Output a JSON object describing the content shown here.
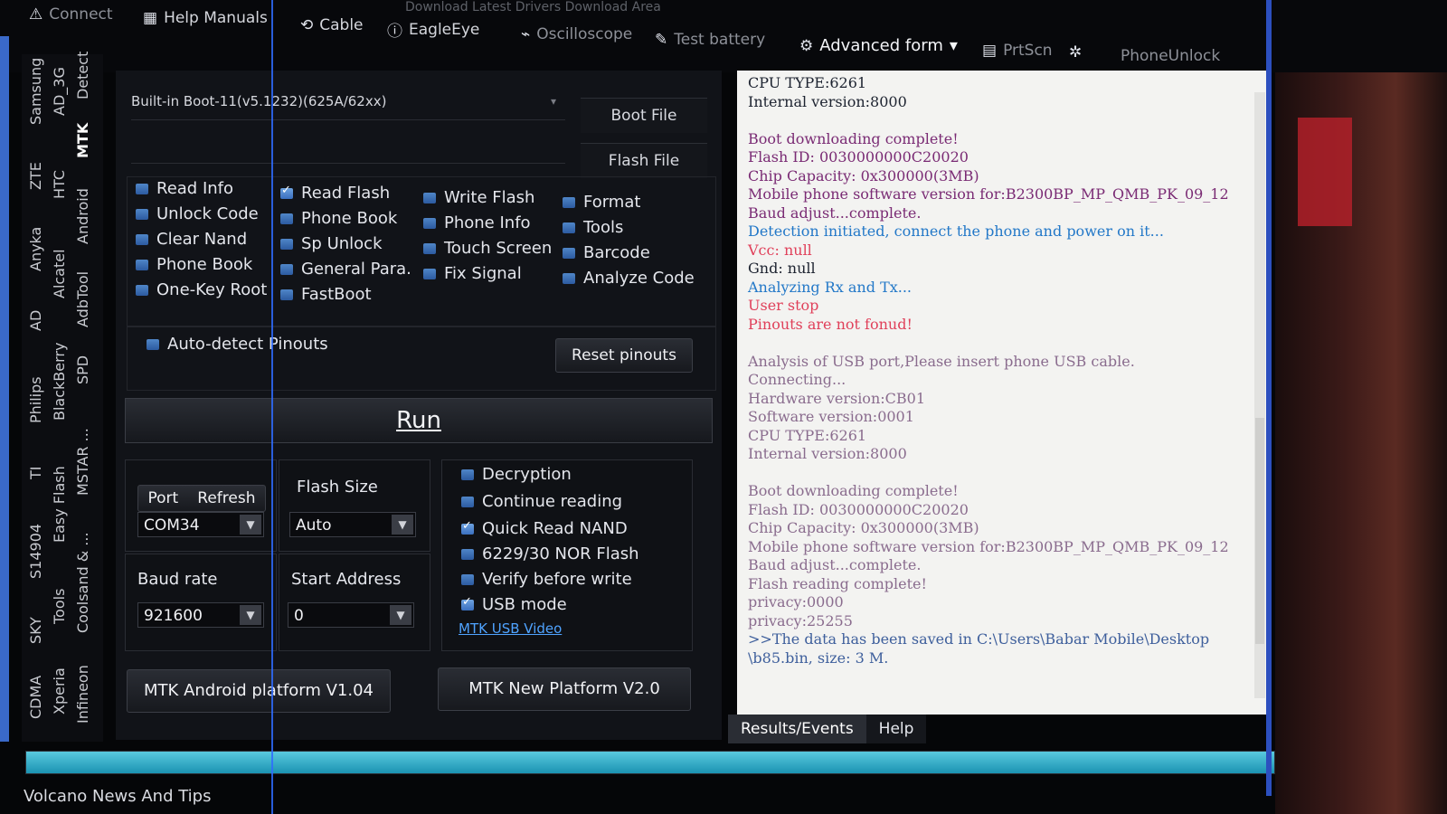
{
  "toolbar": {
    "faint_top": "Download Latest Drivers   Download Area",
    "items": [
      {
        "icon": "warning-icon",
        "glyph": "⚠",
        "label": "Connect"
      },
      {
        "icon": "book-icon",
        "glyph": "▦",
        "label": "Help Manuals"
      },
      {
        "icon": "refresh-icon",
        "glyph": "⟲",
        "label": "Cable"
      },
      {
        "icon": "info-icon",
        "glyph": "ⓘ",
        "label": "EagleEye"
      },
      {
        "icon": "oscilloscope-icon",
        "glyph": "⌁",
        "label": "Oscilloscope"
      },
      {
        "icon": "wrench-icon",
        "glyph": "✎",
        "label": "Test battery"
      },
      {
        "icon": "gear-icon",
        "glyph": "⚙",
        "label": "Advanced form"
      },
      {
        "icon": "screenshot-icon",
        "glyph": "▤",
        "label": "PrtScn"
      },
      {
        "icon": "settings-icon",
        "glyph": "✲",
        "label": ""
      },
      {
        "icon": "apple-icon",
        "glyph": "",
        "label": "PhoneUnlock"
      }
    ]
  },
  "vertical_tabs": {
    "col1": [
      "CDMA",
      "SKY",
      "S14904",
      "TI",
      "Philips",
      "AD",
      "Anyka",
      "ZTE",
      "Samsung"
    ],
    "col2": [
      "Xperia",
      "Tools",
      "Easy Flash",
      "BlackBerry",
      "Alcatel",
      "HTC",
      "AD_3G"
    ],
    "col3": [
      "Infineon",
      "Coolsand & ...",
      "MSTAR ...",
      "SPD",
      "AdbTool",
      "Android",
      "MTK",
      "Detect"
    ],
    "active": "MTK"
  },
  "boot": {
    "combo_value": "Built-in Boot-11(v5.1232)(625A/62xx)",
    "boot_file_btn": "Boot File",
    "flash_file_btn": "Flash File"
  },
  "options": {
    "col1": [
      "Read Info",
      "Unlock Code",
      "Clear Nand",
      "Phone Book",
      "One-Key Root"
    ],
    "col2": [
      "Read Flash",
      "Phone Book",
      "Sp Unlock",
      "General Para.",
      "FastBoot"
    ],
    "col3": [
      "Write Flash",
      "Phone Info",
      "Touch Screen",
      "Fix Signal"
    ],
    "col4": [
      "Format",
      "Tools",
      "Barcode",
      "Analyze Code"
    ],
    "checked": "Read Flash"
  },
  "pinouts": {
    "auto_detect": "Auto-detect Pinouts",
    "reset": "Reset pinouts"
  },
  "run": {
    "label": "Run"
  },
  "port": {
    "port_label": "Port",
    "refresh_label": "Refresh",
    "value": "COM34"
  },
  "flash_size": {
    "label": "Flash Size",
    "value": "Auto"
  },
  "baud": {
    "label": "Baud rate",
    "value": "921600"
  },
  "start_address": {
    "label": "Start Address",
    "value": "0"
  },
  "checks": [
    {
      "label": "Decryption",
      "checked": false
    },
    {
      "label": "Continue reading",
      "checked": false
    },
    {
      "label": "Quick Read NAND",
      "checked": true
    },
    {
      "label": "6229/30 NOR Flash",
      "checked": false
    },
    {
      "label": "Verify before write",
      "checked": false
    },
    {
      "label": "USB mode",
      "checked": true
    }
  ],
  "usb_video_link": "MTK USB Video",
  "platform_buttons": {
    "android": "MTK Android platform V1.04",
    "new": "MTK New Platform V2.0"
  },
  "log": [
    {
      "t": "CPU TYPE:6261",
      "c": "c-d"
    },
    {
      "t": "Internal version:8000",
      "c": "c-d"
    },
    {
      "t": "",
      "c": "c-d"
    },
    {
      "t": "Boot downloading complete!",
      "c": "c-p"
    },
    {
      "t": "Flash ID: 0030000000C20020",
      "c": "c-p"
    },
    {
      "t": "Chip Capacity: 0x300000(3MB)",
      "c": "c-p"
    },
    {
      "t": "Mobile phone software version for:B2300BP_MP_QMB_PK_09_12",
      "c": "c-p"
    },
    {
      "t": "Baud adjust...complete.",
      "c": "c-p"
    },
    {
      "t": "Detection initiated, connect the phone and power on it...",
      "c": "c-b"
    },
    {
      "t": "Vcc: null",
      "c": "c-r"
    },
    {
      "t": "Gnd: null",
      "c": "c-d"
    },
    {
      "t": "Analyzing Rx and Tx...",
      "c": "c-b"
    },
    {
      "t": "User stop",
      "c": "c-r"
    },
    {
      "t": "Pinouts are not fonud!",
      "c": "c-r"
    },
    {
      "t": "",
      "c": "c-d"
    },
    {
      "t": "Analysis of USB port,Please insert phone USB cable.",
      "c": "c-g"
    },
    {
      "t": "Connecting...",
      "c": "c-g"
    },
    {
      "t": "Hardware version:CB01",
      "c": "c-g"
    },
    {
      "t": "Software version:0001",
      "c": "c-g"
    },
    {
      "t": "CPU TYPE:6261",
      "c": "c-g"
    },
    {
      "t": "Internal version:8000",
      "c": "c-g"
    },
    {
      "t": "",
      "c": "c-g"
    },
    {
      "t": "Boot downloading complete!",
      "c": "c-g"
    },
    {
      "t": "Flash ID: 0030000000C20020",
      "c": "c-g"
    },
    {
      "t": "Chip Capacity: 0x300000(3MB)",
      "c": "c-g"
    },
    {
      "t": "Mobile phone software version for:B2300BP_MP_QMB_PK_09_12",
      "c": "c-g"
    },
    {
      "t": "Baud adjust...complete.",
      "c": "c-g"
    },
    {
      "t": "Flash reading complete!",
      "c": "c-g"
    },
    {
      "t": "privacy:0000",
      "c": "c-g"
    },
    {
      "t": "privacy:25255",
      "c": "c-g"
    },
    {
      "t": ">>The data has been saved in C:\\Users\\Babar Mobile\\Desktop",
      "c": "c-s"
    },
    {
      "t": "\\b85.bin, size: 3 M.",
      "c": "c-s"
    }
  ],
  "log_tabs": [
    "Results/Events",
    "Help"
  ],
  "progress": {
    "fraction": 1.0
  },
  "status_text": "Volcano News And Tips"
}
